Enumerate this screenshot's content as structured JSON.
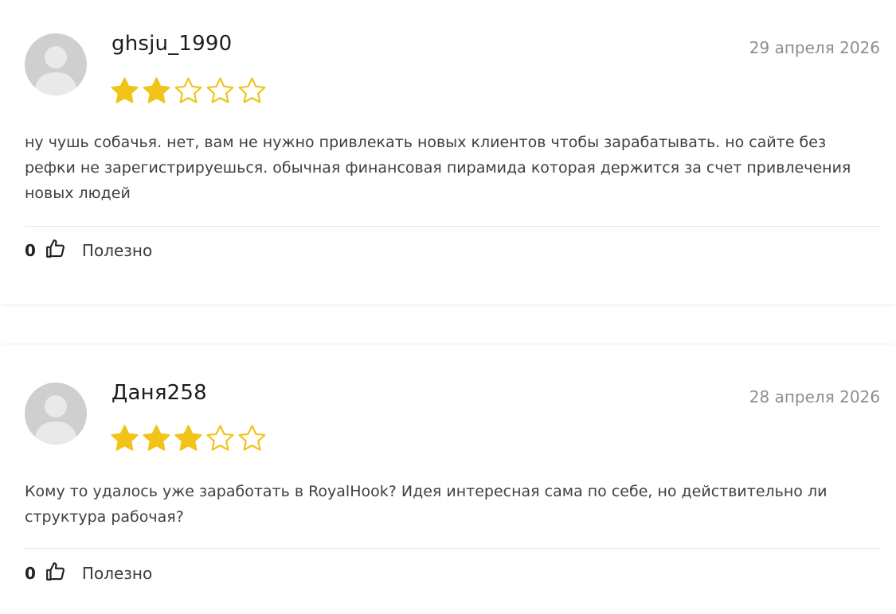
{
  "colors": {
    "star_filled": "#f2c318",
    "star_outline": "#f2c318",
    "avatar_bg": "#cfcfcf",
    "avatar_fg": "#e9e9e9",
    "date": "#8e8e8e"
  },
  "reviews": [
    {
      "author": "ghsju_1990",
      "date": "29 апреля 2026",
      "rating": 2,
      "rating_max": 5,
      "text": "ну чушь собачья. нет, вам не нужно привлекать новых клиентов чтобы зарабатывать. но сайте без рефки не зарегистрируешься. обычная финансовая пирамида которая держится за счет привлечения новых людей",
      "helpful_count": "0",
      "helpful_label": "Полезно",
      "icons": {
        "avatar": "user-avatar-icon",
        "like": "thumbs-up-icon"
      }
    },
    {
      "author": "Даня258",
      "date": "28 апреля 2026",
      "rating": 3,
      "rating_max": 5,
      "text": "Кому то удалось уже заработать в RoyalHook? Идея интересная сама по себе, но действительно ли структура рабочая?",
      "helpful_count": "0",
      "helpful_label": "Полезно",
      "icons": {
        "avatar": "user-avatar-icon",
        "like": "thumbs-up-icon"
      }
    }
  ]
}
